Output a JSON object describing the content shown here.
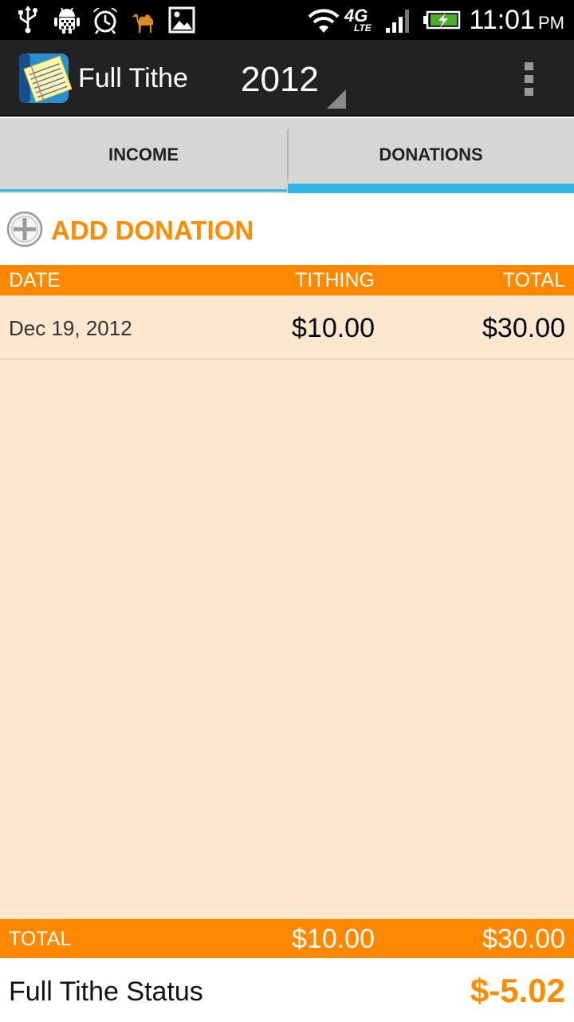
{
  "status_bar": {
    "time": "11:01",
    "ampm": "PM",
    "network_label": "4G",
    "network_sub": "LTE",
    "icons": [
      "usb-icon",
      "android-debug-icon",
      "alarm-icon",
      "camel-app-icon",
      "gallery-icon",
      "wifi-icon",
      "network-4g-lte-icon",
      "signal-icon",
      "battery-charging-icon"
    ]
  },
  "action_bar": {
    "app_title": "Full Tithe",
    "year": "2012"
  },
  "tabs": [
    {
      "label": "INCOME",
      "selected": false
    },
    {
      "label": "DONATIONS",
      "selected": true
    }
  ],
  "add_donation": {
    "label": "ADD DONATION"
  },
  "table": {
    "headers": {
      "date": "DATE",
      "tithing": "TITHING",
      "total": "TOTAL"
    },
    "rows": [
      {
        "date": "Dec 19, 2012",
        "tithing": "$10.00",
        "total": "$30.00"
      }
    ]
  },
  "totals": {
    "label": "TOTAL",
    "tithing": "$10.00",
    "total": "$30.00"
  },
  "status": {
    "label": "Full Tithe Status",
    "value": "$-5.02"
  },
  "colors": {
    "accent_orange": "#ff8800",
    "tab_indicator": "#33b5e5",
    "row_background": "#fde8cf",
    "action_bar": "#222222"
  }
}
